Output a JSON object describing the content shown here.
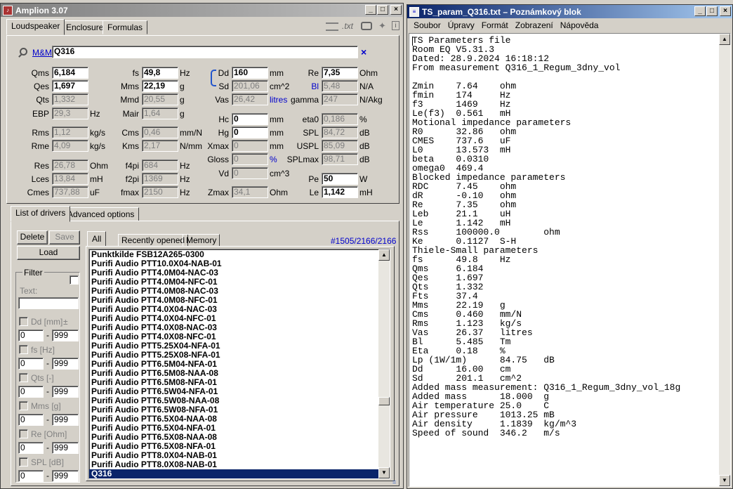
{
  "amplion": {
    "title": "Amplion 3.07",
    "tabs": [
      "Loudspeaker",
      "Enclosure",
      "Formulas"
    ],
    "txt_label": ".txt",
    "search": {
      "label": "M&M",
      "value": "Q316",
      "clear": "×"
    },
    "params": {
      "qms": {
        "label": "Qms",
        "value": "6,184"
      },
      "qes": {
        "label": "Qes",
        "value": "1,697"
      },
      "qts": {
        "label": "Qts",
        "value": "1,332"
      },
      "ebp": {
        "label": "EBP",
        "value": "29,3",
        "unit": "Hz"
      },
      "rms": {
        "label": "Rms",
        "value": "1,12",
        "unit": "kg/s"
      },
      "rme": {
        "label": "Rme",
        "value": "4,09",
        "unit": "kg/s"
      },
      "res": {
        "label": "Res",
        "value": "26,78",
        "unit": "Ohm"
      },
      "lces": {
        "label": "Lces",
        "value": "13,84",
        "unit": "mH"
      },
      "cmes": {
        "label": "Cmes",
        "value": "737,88",
        "unit": "uF"
      },
      "fs": {
        "label": "fs",
        "value": "49,8",
        "unit": "Hz"
      },
      "mms": {
        "label": "Mms",
        "value": "22,19",
        "unit": "g"
      },
      "mmd": {
        "label": "Mmd",
        "value": "20,55",
        "unit": "g"
      },
      "mair": {
        "label": "Mair",
        "value": "1,64",
        "unit": "g"
      },
      "cms": {
        "label": "Cms",
        "value": "0,46",
        "unit": "mm/N"
      },
      "kms": {
        "label": "Kms",
        "value": "2,17",
        "unit": "N/mm"
      },
      "f4pi": {
        "label": "f4pi",
        "value": "684",
        "unit": "Hz"
      },
      "f2pi": {
        "label": "f2pi",
        "value": "1369",
        "unit": "Hz"
      },
      "fmax": {
        "label": "fmax",
        "value": "2150",
        "unit": "Hz"
      },
      "dd": {
        "label": "Dd",
        "value": "160",
        "unit": "mm"
      },
      "sd": {
        "label": "Sd",
        "value": "201,06",
        "unit": "cm^2"
      },
      "vas": {
        "label": "Vas",
        "value": "26,42",
        "unit": "litres"
      },
      "hc": {
        "label": "Hc",
        "value": "0",
        "unit": "mm"
      },
      "hg": {
        "label": "Hg",
        "value": "0",
        "unit": "mm"
      },
      "xmax": {
        "label": "Xmax",
        "value": "0",
        "unit": "mm"
      },
      "gloss": {
        "label": "Gloss",
        "value": "0",
        "unit": "%"
      },
      "vd": {
        "label": "Vd",
        "value": "0",
        "unit": "cm^3"
      },
      "zmax": {
        "label": "Zmax",
        "value": "34,1",
        "unit": "Ohm"
      },
      "re": {
        "label": "Re",
        "value": "7,35",
        "unit": "Ohm"
      },
      "bl": {
        "label": "Bl",
        "value": "5,48",
        "unit": "N/A"
      },
      "gamma": {
        "label": "gamma",
        "value": "247",
        "unit": "N/Akg"
      },
      "eta0": {
        "label": "eta0",
        "value": "0,186",
        "unit": "%"
      },
      "spl": {
        "label": "SPL",
        "value": "84,72",
        "unit": "dB"
      },
      "uspl": {
        "label": "USPL",
        "value": "85,09",
        "unit": "dB"
      },
      "splmax": {
        "label": "SPLmax",
        "value": "98,71",
        "unit": "dB"
      },
      "pe": {
        "label": "Pe",
        "value": "50",
        "unit": "W"
      },
      "le": {
        "label": "Le",
        "value": "1,142",
        "unit": "mH"
      }
    },
    "lower_tabs": [
      "List of drivers",
      "Advanced options"
    ],
    "buttons": {
      "delete": "Delete",
      "save": "Save",
      "load": "Load"
    },
    "filter": {
      "title": "Filter",
      "text_label": "Text:",
      "text_value": "",
      "rows": [
        {
          "label": "Dd [mm]",
          "extra": "±",
          "min": "0",
          "max": "999"
        },
        {
          "label": "fs [Hz]",
          "extra": "",
          "min": "0",
          "max": "999"
        },
        {
          "label": "Qts [-]",
          "extra": "",
          "min": "0",
          "max": "999"
        },
        {
          "label": "Mms [g]",
          "extra": "",
          "min": "0",
          "max": "999"
        },
        {
          "label": "Re [Ohm]",
          "extra": "",
          "min": "0",
          "max": "999"
        },
        {
          "label": "SPL [dB]",
          "extra": "",
          "min": "0",
          "max": "999"
        }
      ],
      "dash": "-"
    },
    "list_tabs": [
      "All",
      "Recently opened",
      "Memory"
    ],
    "count": "#1505/2166/2166",
    "drivers": [
      "Punktkilde FSB12A265-0300",
      "Purifi Audio PTT10.0X04-NAB-01",
      "Purifi Audio PTT4.0M04-NAC-03",
      "Purifi Audio PTT4.0M04-NFC-01",
      "Purifi Audio PTT4.0M08-NAC-03",
      "Purifi Audio PTT4.0M08-NFC-01",
      "Purifi Audio PTT4.0X04-NAC-03",
      "Purifi Audio PTT4.0X04-NFC-01",
      "Purifi Audio PTT4.0X08-NAC-03",
      "Purifi Audio PTT4.0X08-NFC-01",
      "Purifi Audio PTT5.25X04-NFA-01",
      "Purifi Audio PTT5.25X08-NFA-01",
      "Purifi Audio PTT6.5M04-NFA-01",
      "Purifi Audio PTT6.5M08-NAA-08",
      "Purifi Audio PTT6.5M08-NFA-01",
      "Purifi Audio PTT6.5W04-NFA-01",
      "Purifi Audio PTT6.5W08-NAA-08",
      "Purifi Audio PTT6.5W08-NFA-01",
      "Purifi Audio PTT6.5X04-NAA-08",
      "Purifi Audio PTT6.5X04-NFA-01",
      "Purifi Audio PTT6.5X08-NAA-08",
      "Purifi Audio PTT6.5X08-NFA-01",
      "Purifi Audio PTT8.0X04-NAB-01",
      "Purifi Audio PTT8.0X08-NAB-01",
      "Q316"
    ],
    "selected_driver": "Q316"
  },
  "notepad": {
    "title": "TS_param_Q316.txt – Poznámkový blok",
    "menu": [
      "Soubor",
      "Úpravy",
      "Formát",
      "Zobrazení",
      "Nápověda"
    ],
    "text": "TS Parameters file\nRoom EQ V5.31.3\nDated: 28.9.2024 16:18:12\nFrom measurement Q316_1_Regum_3dny_vol\n\nZmin    7.64    ohm\nfmin    174     Hz\nf3      1469    Hz\nLe(f3)  0.561   mH\nMotional impedance parameters\nR0      32.86   ohm\nCMES    737.6   uF\nL0      13.573  mH\nbeta    0.0310\nomega0  469.4\nBlocked impedance parameters\nRDC     7.45    ohm\ndR      -0.10   ohm\nRe      7.35    ohm\nLeb     21.1    uH\nLe      1.142   mH\nRss     100000.0        ohm\nKe      0.1127  S-H\nThiele-Small parameters\nfs      49.8    Hz\nQms     6.184\nQes     1.697\nQts     1.332\nFts     37.4\nMms     22.19   g\nCms     0.460   mm/N\nRms     1.123   kg/s\nVas     26.37   litres\nBl      5.485   Tm\nEta     0.18    %\nLp (1W/1m)      84.75   dB\nDd      16.00   cm\nSd      201.1   cm^2\nAdded mass measurement: Q316_1_Regum_3dny_vol_18g\nAdded mass      18.000  g\nAir temperature 25.0    C\nAir pressure    1013.25 mB\nAir density     1.1839  kg/m^3\nSpeed of sound  346.2   m/s"
  }
}
